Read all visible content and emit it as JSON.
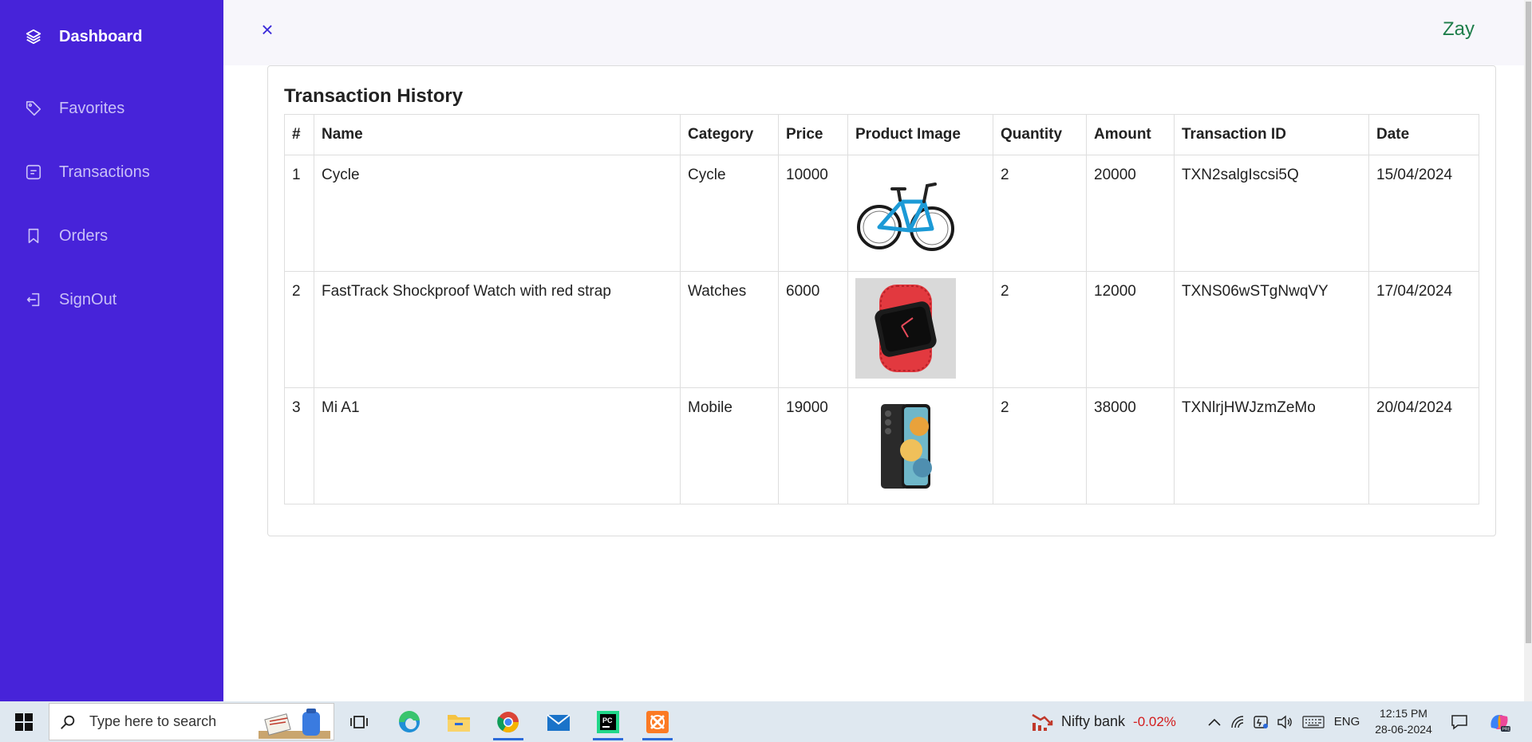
{
  "sidebar": {
    "items": [
      {
        "label": "Dashboard",
        "icon": "layers-icon"
      },
      {
        "label": "Favorites",
        "icon": "tag-icon"
      },
      {
        "label": "Transactions",
        "icon": "receipt-icon"
      },
      {
        "label": "Orders",
        "icon": "bookmark-icon"
      },
      {
        "label": "SignOut",
        "icon": "signout-icon"
      }
    ]
  },
  "header": {
    "close_icon": "×",
    "user_name": "Zay"
  },
  "main": {
    "title": "Transaction History",
    "columns": [
      "#",
      "Name",
      "Category",
      "Price",
      "Product Image",
      "Quantity",
      "Amount",
      "Transaction ID",
      "Date"
    ],
    "rows": [
      {
        "num": "1",
        "name": "Cycle",
        "category": "Cycle",
        "price": "10000",
        "image": "bicycle-image",
        "quantity": "2",
        "amount": "20000",
        "txn_id": "TXN2salgIscsi5Q",
        "date": "15/04/2024"
      },
      {
        "num": "2",
        "name": "FastTrack Shockproof Watch with red strap",
        "category": "Watches",
        "price": "6000",
        "image": "watch-image",
        "quantity": "2",
        "amount": "12000",
        "txn_id": "TXNS06wSTgNwqVY",
        "date": "17/04/2024"
      },
      {
        "num": "3",
        "name": "Mi A1",
        "category": "Mobile",
        "price": "19000",
        "image": "phone-image",
        "quantity": "2",
        "amount": "38000",
        "txn_id": "TXNlrjHWJzmZeMo",
        "date": "20/04/2024"
      }
    ]
  },
  "taskbar": {
    "search_placeholder": "Type here to search",
    "widget_name": "Nifty bank",
    "widget_change": "-0.02%",
    "language": "ENG",
    "time": "12:15 PM",
    "date": "28-06-2024"
  },
  "colors": {
    "sidebar": "#4723d9",
    "accent": "#3a2ad9",
    "user_name": "#1e7e4a",
    "negative": "#d31c1c"
  }
}
